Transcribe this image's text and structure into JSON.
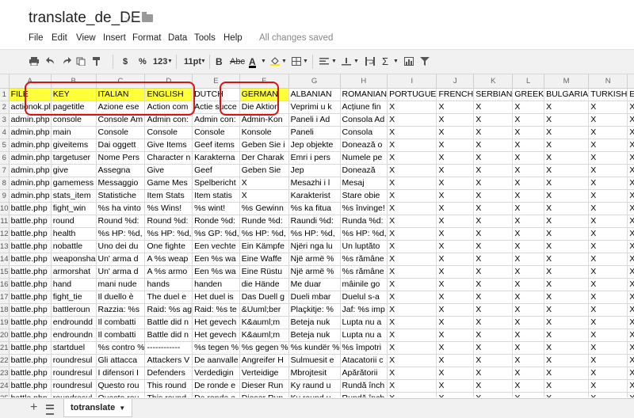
{
  "doc": {
    "title": "translate_de_DE"
  },
  "menu": {
    "items": [
      "File",
      "Edit",
      "View",
      "Insert",
      "Format",
      "Data",
      "Tools",
      "Help"
    ],
    "status": "All changes saved"
  },
  "toolbar": {
    "currency": "$",
    "percent": "%",
    "numfmt": "123",
    "fontsize": "11pt",
    "bold": "B",
    "abc": "Abc",
    "textcolor": "A"
  },
  "grid": {
    "columns": [
      "A",
      "B",
      "C",
      "D",
      "E",
      "F",
      "G",
      "H",
      "I",
      "J",
      "K",
      "L",
      "M",
      "N",
      "O"
    ],
    "rows": [
      [
        "FILE",
        "KEY",
        "ITALIAN",
        "ENGLISH",
        "DUTCH",
        "GERMAN",
        "ALBANIAN",
        "ROMANIAN",
        "PORTUGUE",
        "FRENCH",
        "SERBIAN",
        "GREEK",
        "BULGARIA",
        "TURKISH",
        "ESPANOL"
      ],
      [
        "actionok.pl",
        "pagetitle",
        "Azione ese",
        "Action com",
        "Actie succe",
        "Die Aktion",
        "Veprimi u k",
        "Acțiune fin",
        "X",
        "X",
        "X",
        "X",
        "X",
        "X",
        "X"
      ],
      [
        "admin.php",
        "console",
        "Console Am",
        "Admin con:",
        "Admin con:",
        "Admin-Kon",
        "Paneli i Ad",
        "Consola Ad",
        "X",
        "X",
        "X",
        "X",
        "X",
        "X",
        "X"
      ],
      [
        "admin.php",
        "main",
        "Console",
        "Console",
        "Console",
        "Konsole",
        "Paneli",
        "Consola",
        "X",
        "X",
        "X",
        "X",
        "X",
        "X",
        "X"
      ],
      [
        "admin.php",
        "giveitems",
        "Dai oggett",
        "Give Items",
        "Geef items",
        "Geben Sie i",
        "Jep objekte",
        "Donează o",
        "X",
        "X",
        "X",
        "X",
        "X",
        "X",
        "X"
      ],
      [
        "admin.php",
        "targetuser",
        "Nome Pers",
        "Character n",
        "Karakterna",
        "Der Charak",
        "Emri i pers",
        "Numele pe",
        "X",
        "X",
        "X",
        "X",
        "X",
        "X",
        "X"
      ],
      [
        "admin.php",
        "give",
        "Assegna",
        "Give",
        "Geef",
        "Geben Sie",
        "Jep",
        "Donează",
        "X",
        "X",
        "X",
        "X",
        "X",
        "X",
        "X"
      ],
      [
        "admin.php",
        "gamemess",
        "Messaggio",
        "Game Mes",
        "Spelbericht",
        "X",
        "Mesazhi i l",
        "Mesaj",
        "X",
        "X",
        "X",
        "X",
        "X",
        "X",
        "X"
      ],
      [
        "admin.php",
        "stats_item",
        "Statistiche",
        "Item Stats",
        "Item statis",
        "X",
        "Karakterist",
        "Stare obie",
        "X",
        "X",
        "X",
        "X",
        "X",
        "X",
        "X"
      ],
      [
        "battle.php",
        "fight_win",
        "%s ha vinto",
        "%s Wins!",
        "%s wint!",
        "%s Gewinn",
        "%s ka fitua",
        "%s învinge!",
        "X",
        "X",
        "X",
        "X",
        "X",
        "X",
        "X"
      ],
      [
        "battle.php",
        "round",
        "Round %d:",
        "Round %d:",
        "Ronde %d:",
        "Runde %d:",
        "Raundi %d:",
        "Runda %d:",
        "X",
        "X",
        "X",
        "X",
        "X",
        "X",
        "X"
      ],
      [
        "battle.php",
        "health",
        "%s HP: %d,",
        "%s HP: %d,",
        "%s GP: %d,",
        "%s HP: %d,",
        "%s HP: %d,",
        "%s HP: %d,",
        "X",
        "X",
        "X",
        "X",
        "X",
        "X",
        "X"
      ],
      [
        "battle.php",
        "nobattle",
        "Uno dei du",
        "One fighte",
        "Een vechte",
        "Ein Kämpfe",
        "Njëri nga lu",
        "Un luptăto",
        "X",
        "X",
        "X",
        "X",
        "X",
        "X",
        "X"
      ],
      [
        "battle.php",
        "weaponsha",
        "Un' arma d",
        "A %s weap",
        "Een %s wa",
        "Eine Waffe",
        "Një armë %",
        "%s rămâne",
        "X",
        "X",
        "X",
        "X",
        "X",
        "X",
        "X"
      ],
      [
        "battle.php",
        "armorshat",
        "Un' arma d",
        "A %s armo",
        "Een %s wa",
        "Eine Rüstu",
        "Një armë %",
        "%s rămâne",
        "X",
        "X",
        "X",
        "X",
        "X",
        "X",
        "X"
      ],
      [
        "battle.php",
        "hand",
        "mani nude",
        "hands",
        "handen",
        "die Hände",
        "Me duar",
        "mâinile go",
        "X",
        "X",
        "X",
        "X",
        "X",
        "X",
        "X"
      ],
      [
        "battle.php",
        "fight_tie",
        "Il duello è",
        "The duel e",
        "Het duel is",
        "Das Duell g",
        "Dueli mbar",
        "Duelul s-a",
        "X",
        "X",
        "X",
        "X",
        "X",
        "X",
        "X"
      ],
      [
        "battle.php",
        "battleroun",
        "Razzia: %s",
        "Raid: %s ag",
        "Raid: %s te",
        "&Uuml;ber",
        "Plaçkitje: %",
        "Jaf: %s imp",
        "X",
        "X",
        "X",
        "X",
        "X",
        "X",
        "X"
      ],
      [
        "battle.php",
        "endroundd",
        "Il combatti",
        "Battle did n",
        "Het gevech",
        "K&auml;m",
        "Beteja nuk",
        "Lupta nu a",
        "X",
        "X",
        "X",
        "X",
        "X",
        "X",
        "X"
      ],
      [
        "battle.php",
        "endroundn",
        "Il combatti",
        "Battle did n",
        "Het gevech",
        "K&auml;m",
        "Beteja nuk",
        "Lupta nu a",
        "X",
        "X",
        "X",
        "X",
        "X",
        "X",
        "X"
      ],
      [
        "battle.php",
        "startduel",
        "%s contro %",
        "------------",
        "%s tegen %",
        "%s gegen %",
        "%s kundër %",
        "%s împotri",
        "X",
        "X",
        "X",
        "X",
        "X",
        "X",
        "X"
      ],
      [
        "battle.php",
        "roundresul",
        "Gli attacca",
        "Attackers V",
        "De aanvalle",
        "Angreifer H",
        "Sulmuesit e",
        "Atacatorii c",
        "X",
        "X",
        "X",
        "X",
        "X",
        "X",
        "X"
      ],
      [
        "battle.php",
        "roundresul",
        "I difensori I",
        "Defenders",
        "Verdedigin",
        "Verteidige",
        "Mbrojtesit",
        "Apărătorii",
        "X",
        "X",
        "X",
        "X",
        "X",
        "X",
        "X"
      ],
      [
        "battle.php",
        "roundresul",
        "Questo rou",
        "This round",
        "De ronde e",
        "Dieser Run",
        "Ky raund u",
        "Rundă înch",
        "X",
        "X",
        "X",
        "X",
        "X",
        "X",
        "X"
      ],
      [
        "battle.php",
        "roundresul",
        "Questo rou",
        "This round",
        "De ronde e",
        "Dieser Run",
        "Ky raund u",
        "Rundă înch",
        "X",
        "X",
        "X",
        "X",
        "X",
        "X",
        "X"
      ]
    ]
  },
  "sheets": {
    "active": "totranslate"
  }
}
